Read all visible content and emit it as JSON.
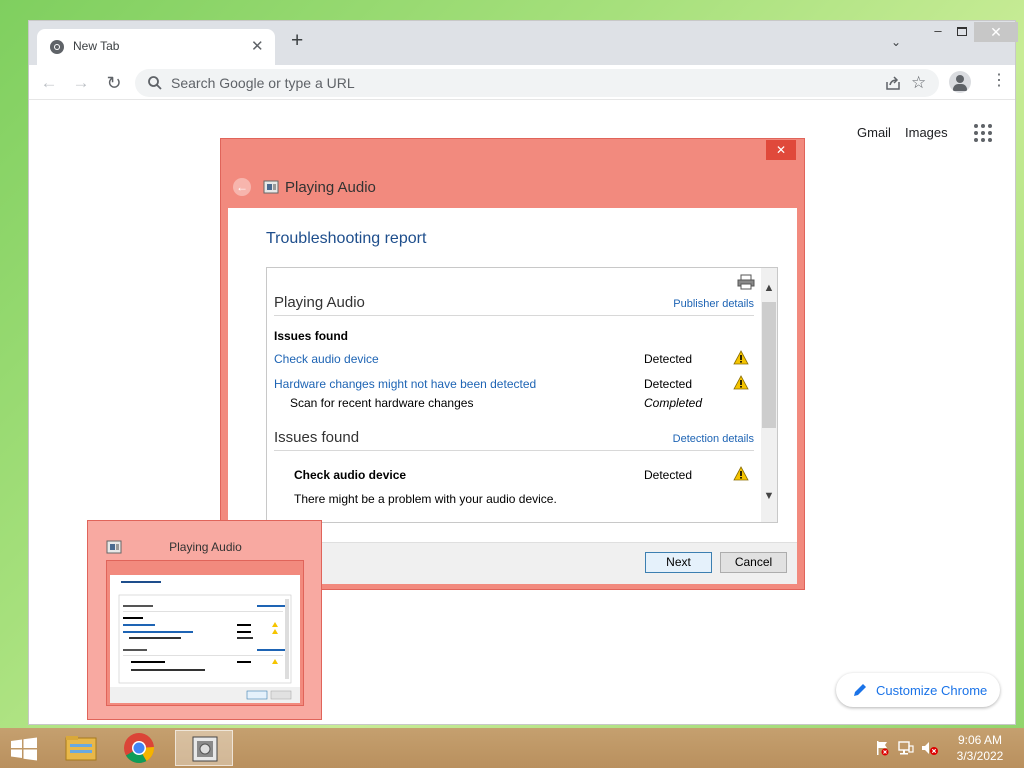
{
  "browser": {
    "tab_title": "New Tab",
    "tab_close": "✕",
    "new_tab": "+",
    "tab_search": "⌄",
    "window_min": "–",
    "window_close": "✕",
    "back": "←",
    "forward": "→",
    "reload": "↻",
    "omnibox_placeholder": "Search Google or type a URL",
    "menu": "⋮",
    "ntp_links": [
      "Gmail",
      "Images"
    ],
    "customize_label": "Customize Chrome",
    "accent_color": "#1a73e8"
  },
  "dialog": {
    "title": "Playing Audio",
    "close": "✕",
    "back": "←",
    "heading": "Troubleshooting report",
    "sections": [
      {
        "title": "Playing Audio",
        "link": "Publisher details",
        "subheading": "Issues found",
        "issues": [
          {
            "label": "Check audio device",
            "status": "Detected",
            "icon": "warning-icon"
          },
          {
            "label": "Hardware changes might not have been detected",
            "status": "Detected",
            "icon": "warning-icon"
          }
        ],
        "step": {
          "label": "Scan for recent hardware changes",
          "status": "Completed"
        }
      },
      {
        "title": "Issues found",
        "link": "Detection details",
        "detail": {
          "label": "Check audio device",
          "status": "Detected",
          "icon": "warning-icon",
          "description": "There might be a problem with your audio device."
        }
      }
    ],
    "buttons": {
      "next": "Next",
      "cancel": "Cancel"
    },
    "frame_color": "#f28a7e",
    "link_color": "#1e64b4",
    "heading_color": "#1e4e8c"
  },
  "thumbnail": {
    "title": "Playing Audio"
  },
  "taskbar": {
    "apps": [
      "file-explorer-icon",
      "chrome-icon",
      "troubleshooter-icon"
    ],
    "tray_icons": [
      "action-center-flag-icon",
      "network-icon",
      "volume-muted-icon"
    ],
    "time": "9:06 AM",
    "date": "3/3/2022"
  }
}
